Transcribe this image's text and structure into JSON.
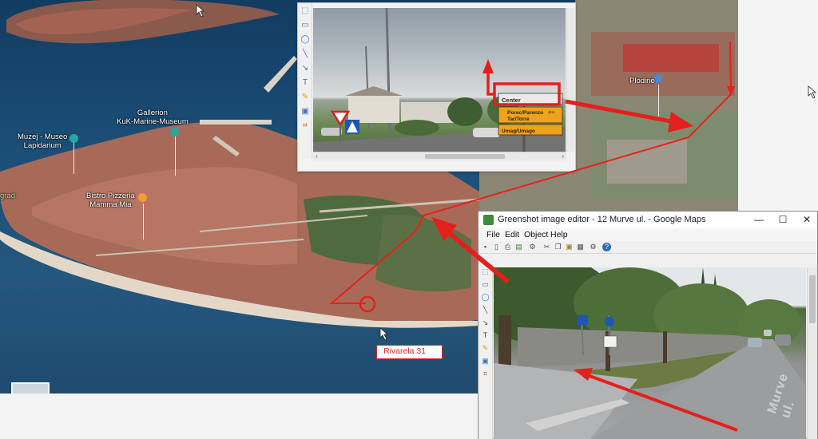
{
  "map": {
    "pois": [
      {
        "label": "Muzej - Museo\nLapidarium",
        "pin": "museum-pin-icon"
      },
      {
        "label": "Gallerion\nKuK-Marine-Museum",
        "pin": "museum-pin-icon"
      },
      {
        "label": "Bistro Pizzeria\nMamma Mia",
        "pin": "restaurant-pin-icon"
      },
      {
        "label": "Plodine",
        "pin": "shop-pin-icon"
      }
    ],
    "edge_label": "grad",
    "annotation": "Rivarela 31",
    "colors": {
      "sea": "#1c4f78",
      "roofs": "#b5695a",
      "arrow": "#e8201c"
    }
  },
  "street_inset": {
    "sign_main": "Center",
    "sign_rows": [
      "Porec/Parenzo",
      "Tar/Torre",
      "Umag/Umago"
    ],
    "sign_distance": "4km"
  },
  "greenshot": {
    "title": "Greenshot image editor - 12 Murve ul. - Google Maps",
    "window_controls": {
      "minimize": "—",
      "maximize": "☐",
      "close": "✕"
    },
    "menu": [
      "File",
      "Edit",
      "Object",
      "Help"
    ],
    "street_name": "Murve ul."
  }
}
